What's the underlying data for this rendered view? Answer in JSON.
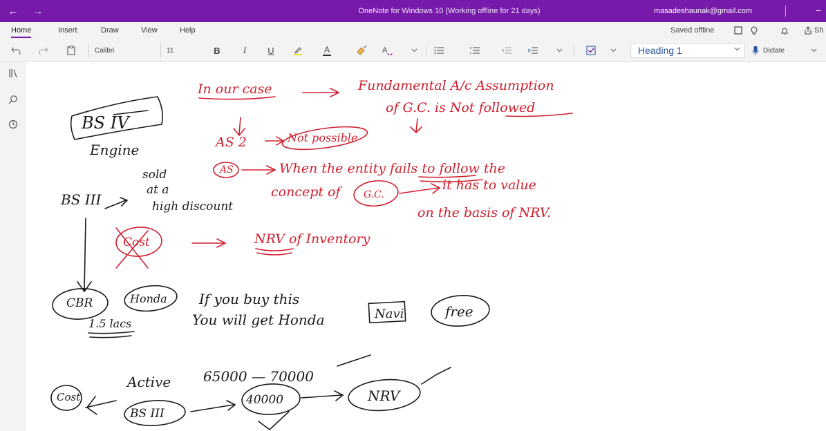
{
  "titlebar": {
    "title": "OneNote for Windows 10 (Working offline for 21 days)",
    "account": "masadeshaunak@gmail.com",
    "back_icon": "←",
    "forward_icon": "→",
    "minimize_icon": "−"
  },
  "menu": {
    "tabs": [
      "Home",
      "Insert",
      "Draw",
      "View",
      "Help"
    ],
    "saved_status": "Saved offline",
    "share_label": "Sh"
  },
  "toolbar": {
    "font_name": "Calibri",
    "font_size": "11",
    "bold": "B",
    "italic": "I",
    "underline": "U",
    "font_color": "A",
    "style_value": "Heading 1",
    "dictate_label": "Dictate"
  },
  "colors": {
    "accent": "#7719aa",
    "ink_red": "#d0202e",
    "ink_black": "#1a1a1a"
  },
  "notes": {
    "red": {
      "line1": "In our case",
      "line1b": "Fundamental A/c Assumption",
      "line2": "of G.C. is Not followed",
      "line3a": "AS 2",
      "line3b": "Not possible",
      "line4a": "AS",
      "line4b": "When the entity fails to follow the",
      "line5a": "concept of",
      "line5b": "G.C.",
      "line5c": "it has to value",
      "line6": "on the basis of NRV.",
      "line7a": "Cost",
      "line7b": "NRV of Inventory"
    },
    "black": {
      "bs4": "BS IV",
      "engine": "Engine",
      "bs3": "BS III",
      "sold": "sold",
      "ata": "at a",
      "discount": "high discount",
      "cbr": "CBR",
      "honda": "Honda",
      "lacs": "1.5 lacs",
      "offer1": "If you buy this",
      "offer2": "You will get Honda",
      "navi": "Navi",
      "free": "free",
      "active": "Active",
      "range": "65000 — 70000",
      "cost": "Cost",
      "bs3b": "BS III",
      "val": "40000",
      "nrv": "NRV"
    }
  }
}
